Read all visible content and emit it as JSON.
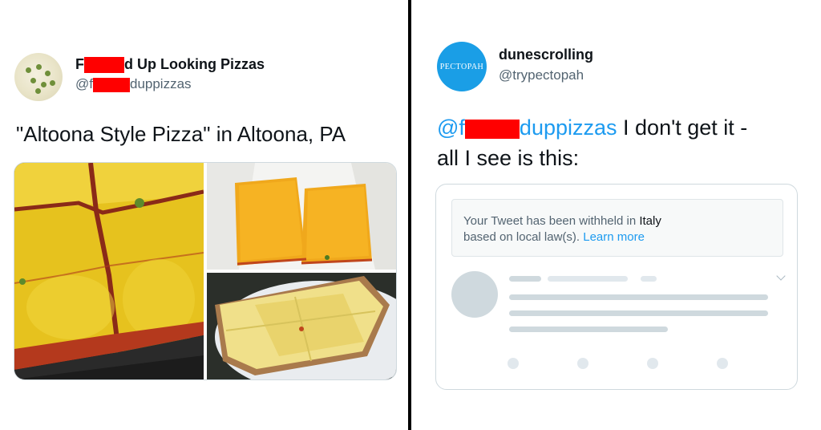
{
  "left_tweet": {
    "name_start": "F",
    "name_end": "d Up Looking Pizzas",
    "handle_start": "@f",
    "handle_end": "duppizzas",
    "text": "\"Altoona Style Pizza\" in Altoona, PA"
  },
  "right_tweet": {
    "avatar_text": "PECTOPAH",
    "name": "dunescrolling",
    "handle": "@trypectopah",
    "mention_start": "@f",
    "mention_end": "duppizzas",
    "text_line1": "I don't get it -",
    "text_line2": "all I see is this:",
    "embed": {
      "notice_prefix": "Your Tweet has been withheld in ",
      "country": "Italy",
      "notice_line2": "based on local law(s). ",
      "learn_more": "Learn more"
    }
  },
  "colors": {
    "redaction": "#ff0000",
    "link": "#1d9bf0",
    "avatar_right": "#1a9ee6",
    "divider": "#000000"
  }
}
